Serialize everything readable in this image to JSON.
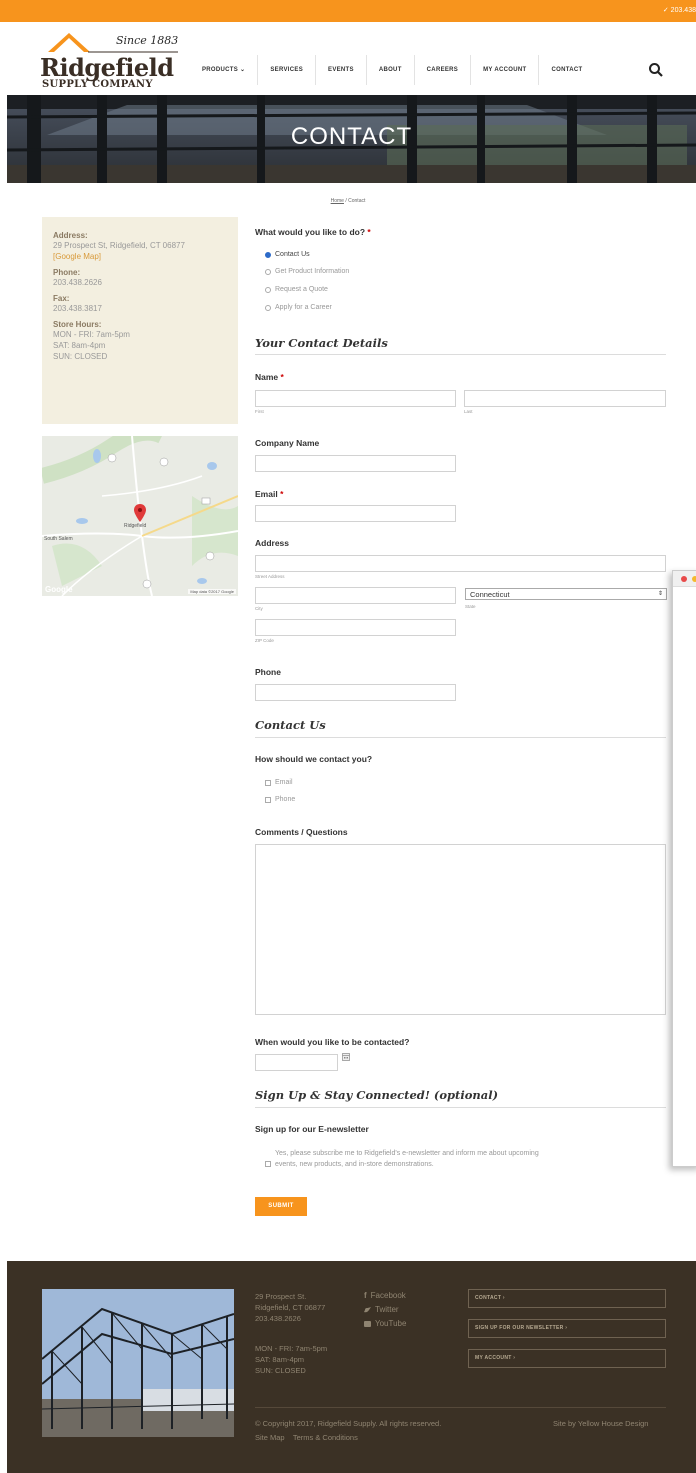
{
  "topbar": {
    "phone": "✓ 203.438"
  },
  "logo": {
    "since": "Since 1883",
    "name": "Ridgefield",
    "sub": "SUPPLY COMPANY"
  },
  "nav": {
    "items": [
      "PRODUCTS ⌄",
      "SERVICES",
      "EVENTS",
      "ABOUT",
      "CAREERS",
      "MY ACCOUNT",
      "CONTACT"
    ]
  },
  "hero": {
    "title": "CONTACT"
  },
  "breadcrumb": {
    "home": "Home",
    "current": "/ Contact"
  },
  "info": {
    "address_label": "Address:",
    "address": "29 Prospect St, Ridgefield, CT 06877",
    "map_link": "[Google Map]",
    "phone_label": "Phone:",
    "phone": "203.438.2626",
    "fax_label": "Fax:",
    "fax": "203.438.3817",
    "hours_label": "Store Hours:",
    "hours": [
      "MON - FRI: 7am-5pm",
      "SAT: 8am-4pm",
      "SUN: CLOSED"
    ]
  },
  "map": {
    "google": "Google",
    "data": "Map data ©2017 Google",
    "town1": "Ridgefield",
    "town2": "South Salem"
  },
  "form": {
    "q_do": "What would you like to do?",
    "req": "*",
    "options": [
      "Contact Us",
      "Get Product Information",
      "Request a Quote",
      "Apply for a Career"
    ],
    "section_details": "Your Contact Details",
    "name_label": "Name",
    "first": "First",
    "last": "Last",
    "company_label": "Company Name",
    "email_label": "Email",
    "address_label": "Address",
    "street": "Street Address",
    "city": "City",
    "state": "State",
    "state_value": "Connecticut",
    "zip": "ZIP Code",
    "phone_label": "Phone",
    "section_contact": "Contact Us",
    "how_label": "How should we contact you?",
    "how_options": [
      "Email",
      "Phone"
    ],
    "comments_label": "Comments / Questions",
    "when_label": "When would you like to be contacted?",
    "section_signup": "Sign Up & Stay Connected! (optional)",
    "newsletter_label": "Sign up for our E-newsletter",
    "newsletter_text_1": "Yes, please subscribe me to Ridgefield's e-newsletter and inform me about upcoming",
    "newsletter_text_2": "events, new products, and in-store demonstrations.",
    "submit": "SUBMIT"
  },
  "footer": {
    "address": [
      "29 Prospect St.",
      "Ridgefield, CT 06877",
      "203.438.2626"
    ],
    "hours": [
      "MON - FRI: 7am-5pm",
      "SAT: 8am-4pm",
      "SUN: CLOSED"
    ],
    "social": [
      "Facebook",
      "Twitter",
      "YouTube"
    ],
    "buttons": [
      "CONTACT ›",
      "SIGN UP FOR OUR NEWSLETTER ›",
      "MY ACCOUNT ›"
    ],
    "copyright": "© Copyright 2017, Ridgefield Supply. All rights reserved.",
    "credit": "Site by Yellow House Design",
    "sitemap": "Site Map",
    "terms": "Terms & Conditions"
  },
  "colors": {
    "accent": "#f7941d",
    "footer": "#3b3125",
    "info_bg": "#f3efe0"
  }
}
